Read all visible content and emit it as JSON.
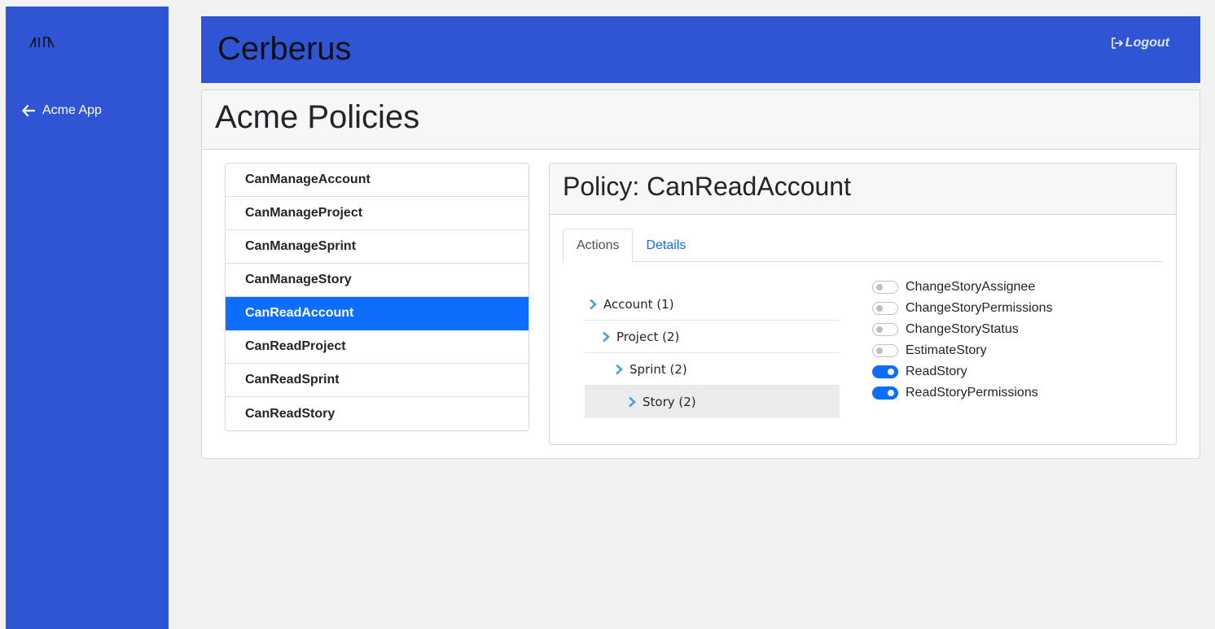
{
  "sidebar": {
    "logo_icon": "aiia-logo",
    "back_icon": "arrow-left-icon",
    "back_label": "Acme App"
  },
  "header": {
    "title": "Cerberus",
    "logout_icon": "logout-icon",
    "logout_label": "Logout"
  },
  "page": {
    "title": "Acme Policies"
  },
  "policies": {
    "items": [
      "CanManageAccount",
      "CanManageProject",
      "CanManageSprint",
      "CanManageStory",
      "CanReadAccount",
      "CanReadProject",
      "CanReadSprint",
      "CanReadStory"
    ],
    "active": "CanReadAccount"
  },
  "detail": {
    "title": "Policy: CanReadAccount",
    "tabs": {
      "actions": "Actions",
      "details": "Details"
    },
    "tree": [
      {
        "label": "Account (1)",
        "depth": 0
      },
      {
        "label": "Project (2)",
        "depth": 1
      },
      {
        "label": "Sprint (2)",
        "depth": 2
      },
      {
        "label": "Story (2)",
        "depth": 3,
        "selected": true
      }
    ],
    "actions": [
      {
        "label": "ChangeStoryAssignee",
        "enabled": false
      },
      {
        "label": "ChangeStoryPermissions",
        "enabled": false
      },
      {
        "label": "ChangeStoryStatus",
        "enabled": false
      },
      {
        "label": "EstimateStory",
        "enabled": false
      },
      {
        "label": "ReadStory",
        "enabled": true
      },
      {
        "label": "ReadStoryPermissions",
        "enabled": true
      }
    ]
  },
  "colors": {
    "brand_blue": "#2f55d4",
    "active_blue": "#0d6efd",
    "chevron": "#4aa3d6"
  }
}
